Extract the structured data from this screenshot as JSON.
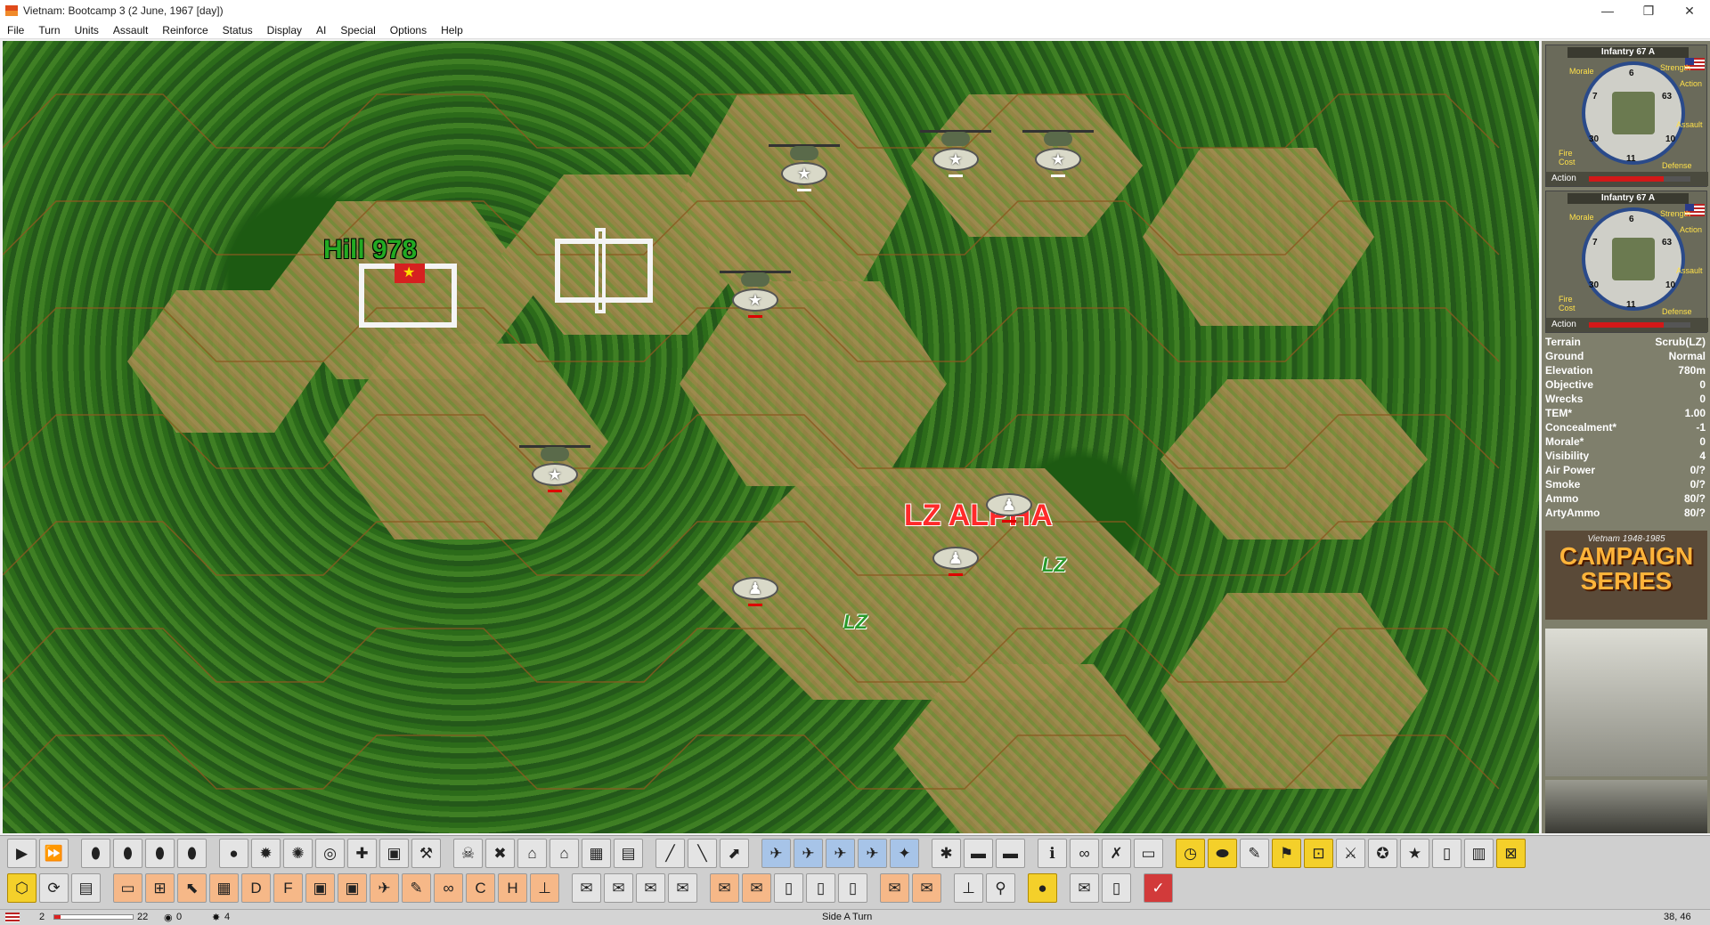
{
  "window": {
    "title": "Vietnam: Bootcamp 3 (2 June, 1967 [day])",
    "minimize_icon": "minimize-icon",
    "maximize_icon": "restore-icon",
    "close_icon": "close-icon"
  },
  "menu": [
    "File",
    "Turn",
    "Units",
    "Assault",
    "Reinforce",
    "Status",
    "Display",
    "AI",
    "Special",
    "Options",
    "Help"
  ],
  "map": {
    "labels": {
      "hill": "Hill 978",
      "lz_alpha": "LZ ALPHA",
      "lz_1": "LZ",
      "lz_2": "LZ"
    },
    "colors": {
      "jungle": "#2f6e1e",
      "clearing": "#a58c52",
      "hill_label": "#22aa22",
      "lz_alpha": "#ff2a2a",
      "hex_line": "#8a5a20"
    }
  },
  "unit_panel": {
    "cards": [
      {
        "title": "Infantry 67 A",
        "morale_label": "Morale",
        "strength_label": "Strength",
        "action_label": "Action",
        "assault_label": "Assault",
        "fire_cost_label": "Fire Cost",
        "defense_label": "Defense",
        "morale": "7",
        "strength_top": "6",
        "strength": "63",
        "fire": "30",
        "cost": "11",
        "defense": "10",
        "action_row_label": "Action"
      },
      {
        "title": "Infantry 67 A",
        "morale_label": "Morale",
        "strength_label": "Strength",
        "action_label": "Action",
        "assault_label": "Assault",
        "fire_cost_label": "Fire Cost",
        "defense_label": "Defense",
        "morale": "7",
        "strength_top": "6",
        "strength": "63",
        "fire": "30",
        "cost": "11",
        "defense": "10",
        "action_row_label": "Action"
      }
    ]
  },
  "terrain_info": [
    {
      "label": "Terrain",
      "value": "Scrub(LZ)"
    },
    {
      "label": "Ground",
      "value": "Normal"
    },
    {
      "label": "Elevation",
      "value": "780m"
    },
    {
      "label": "Objective",
      "value": "0"
    },
    {
      "label": "Wrecks",
      "value": "0"
    },
    {
      "label": "TEM*",
      "value": "1.00"
    },
    {
      "label": "Concealment*",
      "value": "-1"
    },
    {
      "label": "Morale*",
      "value": "0"
    },
    {
      "label": "Visibility",
      "value": "4"
    },
    {
      "label": "Air Power",
      "value": "0/?"
    },
    {
      "label": "Smoke",
      "value": "0/?"
    },
    {
      "label": "Ammo",
      "value": "80/?"
    },
    {
      "label": "ArtyAmmo",
      "value": "80/?"
    }
  ],
  "logo": {
    "small": "Vietnam 1948-1985",
    "big_1": "CAMPAIGN",
    "big_2": "SERIES"
  },
  "toolbar": {
    "row1_icons": [
      "play-icon",
      "fast-forward-icon",
      "grenade-icon",
      "grenade-add-icon",
      "grenade-drop-icon",
      "grenade-multi-icon",
      "smoke-icon",
      "explosion-icon",
      "artillery-fire-icon",
      "target-icon",
      "stretcher-icon",
      "vehicle-icon",
      "wrench-icon",
      "hq-skull-icon",
      "cross-arms-icon",
      "bunker-icon",
      "building-icon",
      "fort-icon",
      "fort-stack-icon",
      "rifle-icon",
      "bayonet-icon",
      "mortar-icon",
      "helicopter-icon",
      "helicopter-up-icon",
      "helicopter-down-icon",
      "helicopter-land-icon",
      "airstrike-icon",
      "mine-icon",
      "truck-icon",
      "truck-load-icon",
      "unit-info-icon",
      "binoculars-icon",
      "crossed-rifles-icon",
      "transport-icon",
      "clock-icon",
      "disk-icon",
      "edit-icon",
      "flag-icon",
      "objective-icon",
      "sword-icon",
      "medal-icon",
      "star-icon",
      "book-icon",
      "map-icon",
      "crosshair-icon"
    ],
    "row2_icons": [
      "hex-grid-icon",
      "refresh-icon",
      "scroll-icon",
      "landscape-icon",
      "plus-house-icon",
      "cursor-icon",
      "wall-icon",
      "defense-icon",
      "fortress-icon",
      "jeep-icon",
      "bus-icon",
      "plane-icon",
      "pencil-icon",
      "binocular-group-icon",
      "c-icon",
      "hq-icon",
      "org-chart-icon",
      "envelope-plus-icon",
      "envelope-multi-icon",
      "envelope-info-icon",
      "envelope-minus-icon",
      "mail-out-icon",
      "mail-in-icon",
      "document-icon",
      "document-plus-icon",
      "document-copy-icon",
      "mail-back-icon",
      "mail-forward-icon",
      "tree-chart-icon",
      "sign-icon",
      "coin-icon",
      "info-mail-icon",
      "info-doc-icon",
      "check-icon"
    ]
  },
  "status": {
    "side_count": "2",
    "strength": "22",
    "losses": "0",
    "vp": "4",
    "turn_text": "Side A Turn",
    "coords": "38, 46",
    "strength_fraction": 0.08
  }
}
